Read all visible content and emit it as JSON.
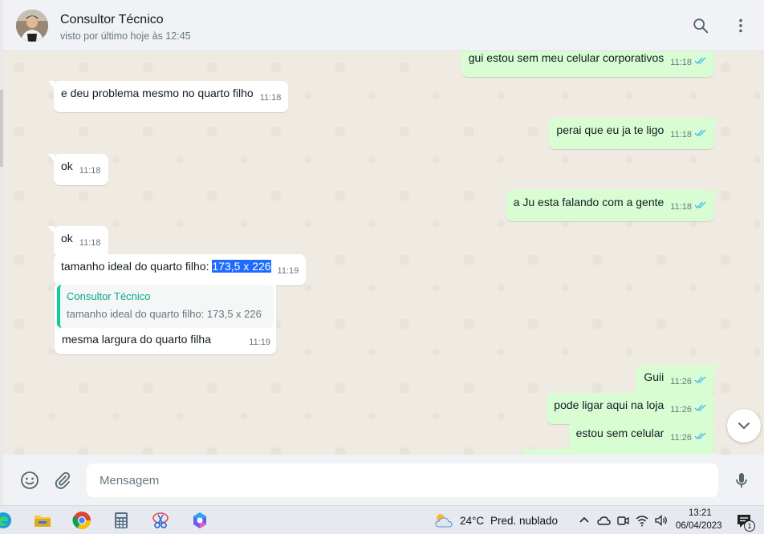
{
  "header": {
    "contact_name": "Consultor Técnico",
    "status": "visto por último hoje às 12:45"
  },
  "messages": [
    {
      "dir": "out",
      "text": "gui estou sem meu celular corporativos",
      "time": "11:18"
    },
    {
      "dir": "in",
      "text": "e deu problema mesmo no quarto filho",
      "time": "11:18"
    },
    {
      "dir": "out",
      "text": "perai que eu ja te ligo",
      "time": "11:18"
    },
    {
      "dir": "in",
      "text": "ok",
      "time": "11:18"
    },
    {
      "dir": "out",
      "text": "a Ju esta falando com a gente",
      "time": "11:18"
    },
    {
      "dir": "in",
      "text": "ok",
      "time": "11:18"
    },
    {
      "dir": "in",
      "text_before": "tamanho ideal do quarto filho: ",
      "text_selected": "173,5 x 226",
      "time": "11:19"
    },
    {
      "dir": "in",
      "quote_author": "Consultor Técnico",
      "quote_text": "tamanho ideal do quarto filho: 173,5 x 226",
      "text": "mesma largura do quarto filha",
      "time": "11:19"
    },
    {
      "dir": "out",
      "text": "Guii",
      "time": "11:26"
    },
    {
      "dir": "out",
      "text": "pode ligar aqui na loja",
      "time": "11:26"
    },
    {
      "dir": "out",
      "text": "estou sem celular",
      "time": "11:26"
    }
  ],
  "composer": {
    "placeholder": "Mensagem"
  },
  "taskbar": {
    "weather_temp": "24°C",
    "weather_desc": "Pred. nublado",
    "time": "13:21",
    "date": "06/04/2023",
    "notification_count": "1"
  },
  "colors": {
    "outgoing_bubble": "#d9fdd3",
    "incoming_bubble": "#ffffff",
    "read_ticks": "#53bdeb",
    "quote_accent": "#06cf9c",
    "selection": "#1d6cff"
  }
}
